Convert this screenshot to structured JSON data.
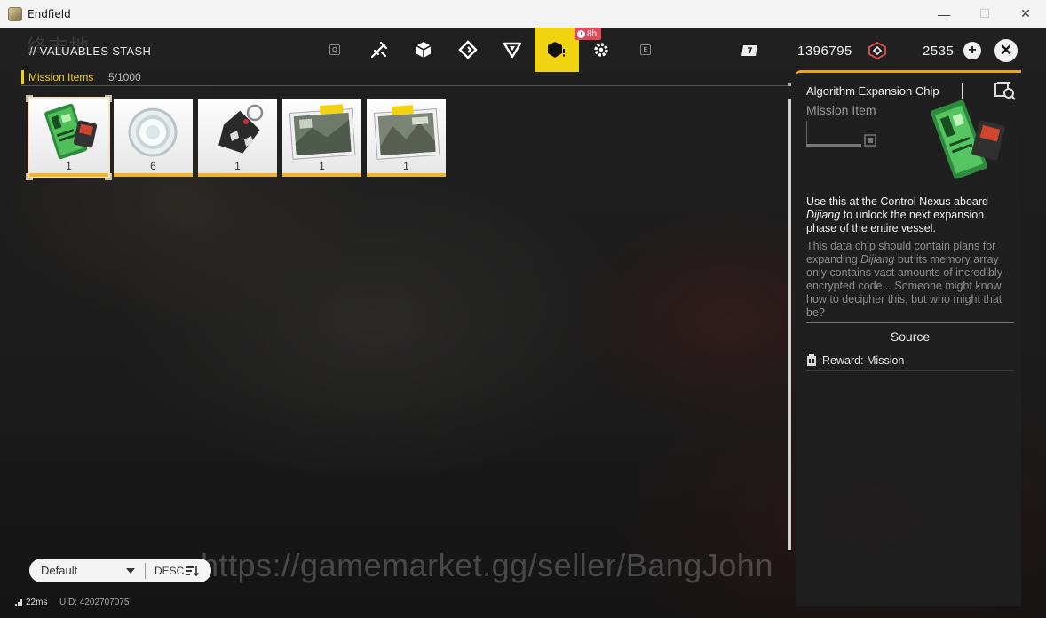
{
  "window": {
    "title": "Endfield",
    "minimize_label": "—",
    "maximize_label": "☐",
    "close_label": "✕"
  },
  "header": {
    "page_title": "// VALUABLES STASH",
    "logo_text": "终末地",
    "tabs": [
      {
        "key": "Q",
        "icon": "keyhint-q"
      },
      {
        "key": "",
        "icon": "weapon-icon"
      },
      {
        "key": "",
        "icon": "cube-icon"
      },
      {
        "key": "",
        "icon": "diamond-arrow-icon"
      },
      {
        "key": "",
        "icon": "triangle-icon"
      },
      {
        "key": "",
        "icon": "valuables-icon",
        "active": true
      },
      {
        "key": "",
        "icon": "gear-icon"
      },
      {
        "key": "E",
        "icon": "keyhint-e"
      }
    ],
    "timer_badge": "8h",
    "currencies": [
      {
        "icon": "ticket-icon",
        "value": "1396795"
      },
      {
        "icon": "origeometry-icon",
        "value": "2535"
      }
    ]
  },
  "category": {
    "label": "Mission Items",
    "count": "5/1000"
  },
  "items": [
    {
      "name": "Algorithm Expansion Chip",
      "qty": "1",
      "art": "chip",
      "selected": true
    },
    {
      "name": "Glass disc",
      "qty": "6",
      "art": "disc"
    },
    {
      "name": "Tag keychain",
      "qty": "1",
      "art": "tag"
    },
    {
      "name": "Photo 1",
      "qty": "1",
      "art": "photo"
    },
    {
      "name": "Photo 2",
      "qty": "1",
      "art": "photo"
    }
  ],
  "detail": {
    "name": "Algorithm Expansion Chip",
    "type": "Mission Item",
    "desc_pre": "Use this at the Control Nexus aboard ",
    "desc_em": "Dijiang",
    "desc_post": " to unlock the next expansion phase of the entire vessel.",
    "lore_pre": "This data chip should contain plans for expanding ",
    "lore_em": "Dijiang",
    "lore_post": " but its memory array only contains vast amounts of incredibly encrypted code... Someone might know how to decipher this, but who might that be?",
    "source_heading": "Source",
    "source_item": "Reward: Mission"
  },
  "sort": {
    "selected": "Default",
    "order": "DESC"
  },
  "watermark": "https://gamemarket.gg/seller/BangJohn",
  "status": {
    "ping": "22ms",
    "uid": "UID: 4202707075"
  },
  "colors": {
    "accent_yellow": "#f2d312",
    "rarity_orange": "#f5b321",
    "panel_border": "#e8a61a",
    "badge_red": "#e24a5a"
  }
}
